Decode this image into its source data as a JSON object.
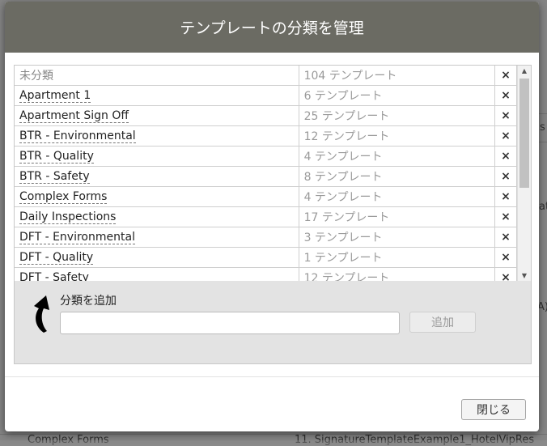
{
  "background": {
    "texts": [
      {
        "name": "bg-text-s",
        "text": "s"
      },
      {
        "name": "bg-text-at",
        "text": "at"
      },
      {
        "name": "bg-text-ax",
        "text": "A)"
      },
      {
        "name": "bg-text-bottom-left",
        "text": "Complex Forms"
      },
      {
        "name": "bg-text-bottom-right",
        "text": "11. SignatureTemplateExample1_HotelVipRes"
      }
    ]
  },
  "modal": {
    "title": "テンプレートの分類を管理",
    "categories": [
      {
        "name": "未分類",
        "count": "104 テンプレート",
        "delete": "×"
      },
      {
        "name": "Apartment 1",
        "count": "6 テンプレート",
        "delete": "×"
      },
      {
        "name": "Apartment Sign Off",
        "count": "25 テンプレート",
        "delete": "×"
      },
      {
        "name": "BTR - Environmental",
        "count": "12 テンプレート",
        "delete": "×"
      },
      {
        "name": "BTR - Quality",
        "count": "4 テンプレート",
        "delete": "×"
      },
      {
        "name": "BTR - Safety",
        "count": "8 テンプレート",
        "delete": "×"
      },
      {
        "name": "Complex Forms",
        "count": "4 テンプレート",
        "delete": "×"
      },
      {
        "name": "Daily Inspections",
        "count": "17 テンプレート",
        "delete": "×"
      },
      {
        "name": "DFT - Environmental",
        "count": "3 テンプレート",
        "delete": "×"
      },
      {
        "name": "DFT - Quality",
        "count": "1 テンプレート",
        "delete": "×"
      },
      {
        "name": "DFT - Safety",
        "count": "12 テンプレート",
        "delete": "×"
      }
    ],
    "add_section": {
      "label": "分類を追加",
      "input_value": "",
      "add_button": "追加"
    },
    "close_button": "閉じる"
  },
  "icons": {
    "scroll_up": "▲",
    "scroll_down": "▼",
    "curved_arrow": "curved-arrow-icon"
  }
}
